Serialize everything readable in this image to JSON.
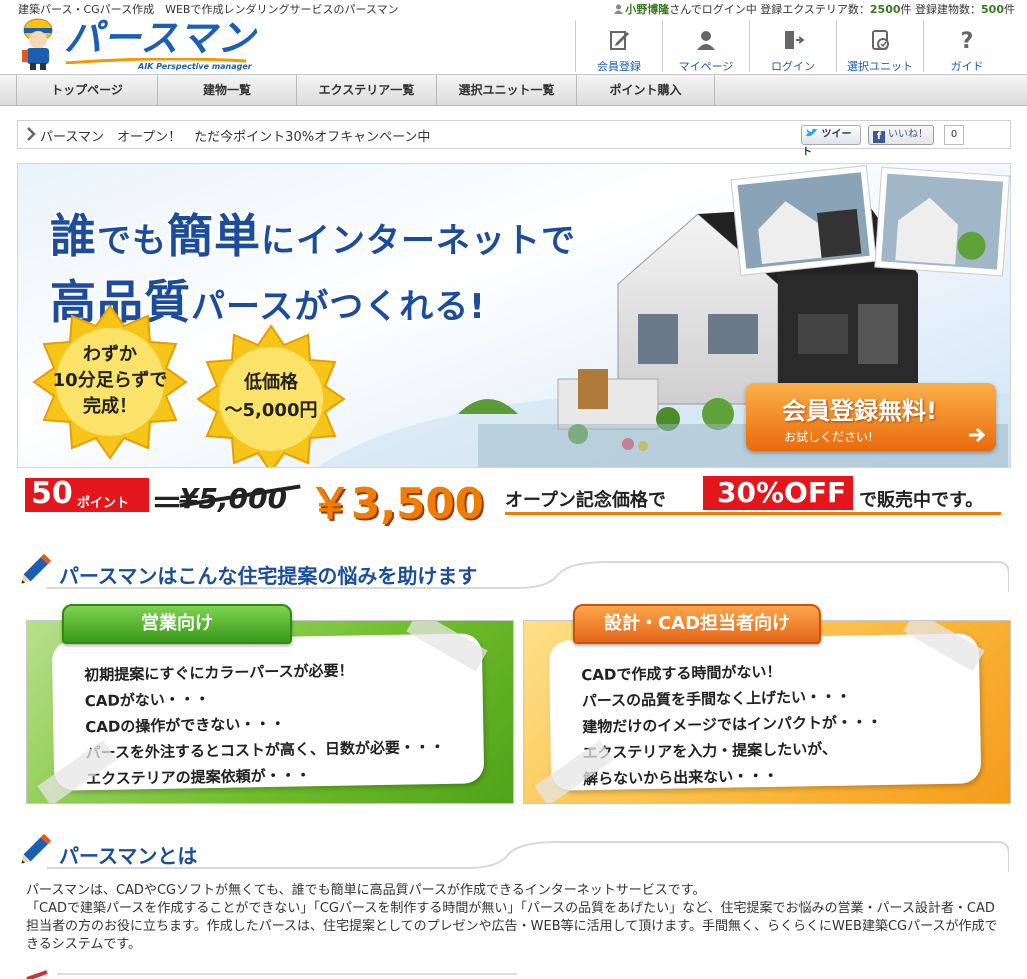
{
  "header": {
    "tagline": "建築パース・CGパース作成　WEBで作成レンダリングサービスのパースマン",
    "user_name": "小野博隆",
    "login_suffix": "さんでログイン中",
    "exterior_label": "登録エクステリア数：",
    "exterior_count": "2500",
    "exterior_unit": "件",
    "building_label": "登録建物数：",
    "building_count": "500",
    "building_unit": "件",
    "logo_text": "パースマン",
    "logo_sub": "AIK Perspective manager"
  },
  "top_nav": [
    {
      "label": "会員登録",
      "icon": "register-icon"
    },
    {
      "label": "マイページ",
      "icon": "person-icon"
    },
    {
      "label": "ログイン",
      "icon": "login-door-icon"
    },
    {
      "label": "選択ユニット",
      "icon": "unit-check-icon"
    },
    {
      "label": "ガイド",
      "icon": "question-icon"
    }
  ],
  "menu": [
    {
      "label": "トップページ"
    },
    {
      "label": "建物一覧"
    },
    {
      "label": "エクステリア一覧"
    },
    {
      "label": "選択ユニット一覧"
    },
    {
      "label": "ポイント購入"
    }
  ],
  "ticker": {
    "text": "パースマン　オープン！　ただ今ポイント30%オフキャンペーン中",
    "tweet_label": "ツイート",
    "like_label": "いいね！",
    "like_count": "0"
  },
  "hero": {
    "line1_a": "誰",
    "line1_b": "でも",
    "line1_c": "簡単",
    "line1_d": "にインターネットで",
    "line2_a": "高品質",
    "line2_b": "パースがつくれる!",
    "badge1": [
      "わずか",
      "10分足らずで",
      "完成！"
    ],
    "badge2": [
      "低価格",
      "～5,000円"
    ],
    "cta_title": "会員登録無料!",
    "cta_sub": "お試しください!"
  },
  "price": {
    "points": "50",
    "points_unit": "ポイント",
    "equals": "＝",
    "old_price": "¥5,000",
    "new_price": "￥3,500",
    "text1": "オープン記念価格で",
    "discount": "30%OFF",
    "text2": "で販売中です。"
  },
  "section1": {
    "title": "パースマンはこんな住宅提案の悩みを助けます",
    "sales": {
      "tab": "営業向け",
      "lines": [
        "初期提案にすぐにカラーパースが必要！",
        "CADがない・・・",
        "CADの操作ができない・・・",
        "パースを外注するとコストが高く、日数が必要・・・",
        "エクステリアの提案依頼が・・・"
      ]
    },
    "design": {
      "tab": "設計・CAD担当者向け",
      "lines": [
        "CADで作成する時間がない！",
        "パースの品質を手間なく上げたい・・・",
        "建物だけのイメージではインパクトが・・・",
        "エクステリアを入力・提案したいが、",
        "解らないから出来ない・・・"
      ]
    }
  },
  "section2": {
    "title": "パースマンとは",
    "p1": "パースマンは、CADやCGソフトが無くても、誰でも簡単に高品質パースが作成できるインターネットサービスです。",
    "p2": "「CADで建築パースを作成することができない」「CGパースを制作する時間が無い」「パースの品質をあげたい」など、住宅提案でお悩みの営業・パース設計者・CAD担当者の方のお役に立ちます。作成したパースは、住宅提案としてのプレゼンや広告・WEB等に活用して頂けます。手間無く、らくらくにWEB建築CGパースが作成できるシステムです。"
  },
  "colors": {
    "brand_blue": "#1a5fb4",
    "accent_green": "#3a7a1e",
    "sale_red": "#e4161b",
    "price_orange": "#f07d00"
  }
}
